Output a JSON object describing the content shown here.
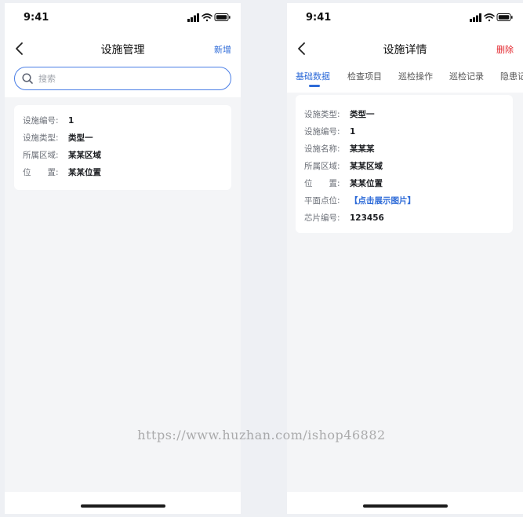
{
  "left_screen": {
    "status_time": "9:41",
    "nav": {
      "title": "设施管理",
      "action": "新增"
    },
    "search": {
      "placeholder": "搜索",
      "value": ""
    },
    "facility_card": {
      "rows": [
        {
          "label": "设施编号:",
          "value": "1"
        },
        {
          "label": "设施类型:",
          "value": "类型一"
        },
        {
          "label": "所属区域:",
          "value": "某某区域"
        },
        {
          "label": "位　　置:",
          "value": "某某位置"
        }
      ]
    }
  },
  "right_screen": {
    "status_time": "9:41",
    "nav": {
      "title": "设施详情",
      "action": "删除"
    },
    "tabs": [
      {
        "label": "基础数据",
        "active": true
      },
      {
        "label": "检查项目",
        "active": false
      },
      {
        "label": "巡检操作",
        "active": false
      },
      {
        "label": "巡检记录",
        "active": false
      },
      {
        "label": "隐患记",
        "active": false
      }
    ],
    "detail_card": {
      "rows": [
        {
          "label": "设施类型:",
          "value": "类型一"
        },
        {
          "label": "设施编号:",
          "value": "1"
        },
        {
          "label": "设施名称:",
          "value": "某某某"
        },
        {
          "label": "所属区域:",
          "value": "某某区域"
        },
        {
          "label": "位　　置:",
          "value": "某某位置"
        },
        {
          "label": "平面点位:",
          "value": "【点击展示图片】"
        },
        {
          "label": "芯片编号:",
          "value": "123456"
        }
      ]
    }
  },
  "watermark": "https://www.huzhan.com/ishop46882",
  "colors": {
    "accent": "#2e6bd8",
    "danger": "#e3262d",
    "background": "#f4f5f7"
  },
  "icons": {
    "status": [
      "signal-icon",
      "wifi-icon",
      "battery-icon"
    ],
    "back": "chevron-left-icon",
    "search": "search-icon"
  }
}
